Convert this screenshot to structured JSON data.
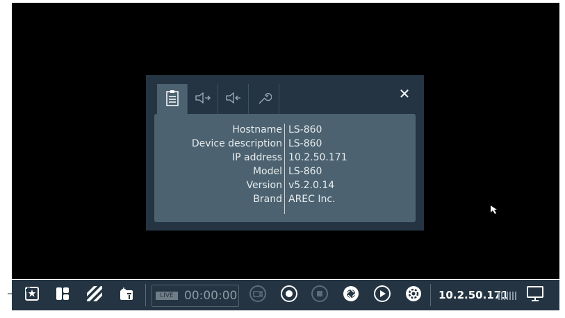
{
  "dialog": {
    "tabs": [
      {
        "icon": "device-info-icon",
        "active": true
      },
      {
        "icon": "audio-in-icon",
        "active": false
      },
      {
        "icon": "audio-out-icon",
        "active": false
      },
      {
        "icon": "wrench-icon",
        "active": false
      }
    ],
    "close_label": "✕",
    "info": [
      {
        "key": "Hostname",
        "value": "LS-860"
      },
      {
        "key": "Device description",
        "value": "LS-860"
      },
      {
        "key": "IP address",
        "value": "10.2.50.171"
      },
      {
        "key": "Model",
        "value": "LS-860"
      },
      {
        "key": "Version",
        "value": "v5.2.0.14"
      },
      {
        "key": "Brand",
        "value": "AREC Inc."
      }
    ]
  },
  "taskbar": {
    "live_badge": "LIVE",
    "timer": "00:00:00",
    "ip": "10.2.50.171",
    "icons": [
      "favorite-layout-icon",
      "layout-icon",
      "stripes-icon",
      "custom-layout-icon",
      "camera-icon",
      "record-icon",
      "stop-icon",
      "shutter-icon",
      "play-icon",
      "settings-icon",
      "signal-bars-icon",
      "monitor-icon"
    ]
  },
  "colors": {
    "background": "#000000",
    "dialog": "#243442",
    "panel": "#4c6270",
    "taskbar": "#243442"
  }
}
